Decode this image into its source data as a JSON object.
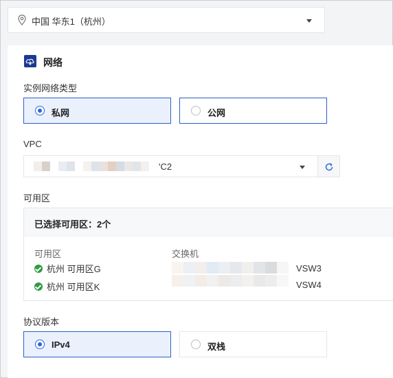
{
  "region": {
    "value": "中国 华东1（杭州）",
    "icon": "location-pin-icon"
  },
  "network": {
    "section_title": "网络",
    "network_type": {
      "label": "实例网络类型",
      "options": [
        {
          "label": "私网",
          "selected": true
        },
        {
          "label": "公网",
          "selected": false
        }
      ]
    },
    "vpc": {
      "label": "VPC",
      "value_suffix": "'C2",
      "refresh_icon": "refresh-icon"
    },
    "zones": {
      "label": "可用区",
      "summary": "已选择可用区：2个",
      "col_zone": "可用区",
      "col_switch": "交换机",
      "rows": [
        {
          "zone": "杭州 可用区G",
          "switch": "VSW3"
        },
        {
          "zone": "杭州 可用区K",
          "switch": "VSW4"
        }
      ]
    },
    "protocol": {
      "label": "协议版本",
      "options": [
        {
          "label": "IPv4",
          "selected": true
        },
        {
          "label": "双栈",
          "selected": false
        }
      ]
    }
  },
  "colors": {
    "accent": "#2c66d6",
    "selected_bg": "#eaf1fd",
    "check_green": "#2e9c3f",
    "section_icon": "#1b3a8f"
  }
}
